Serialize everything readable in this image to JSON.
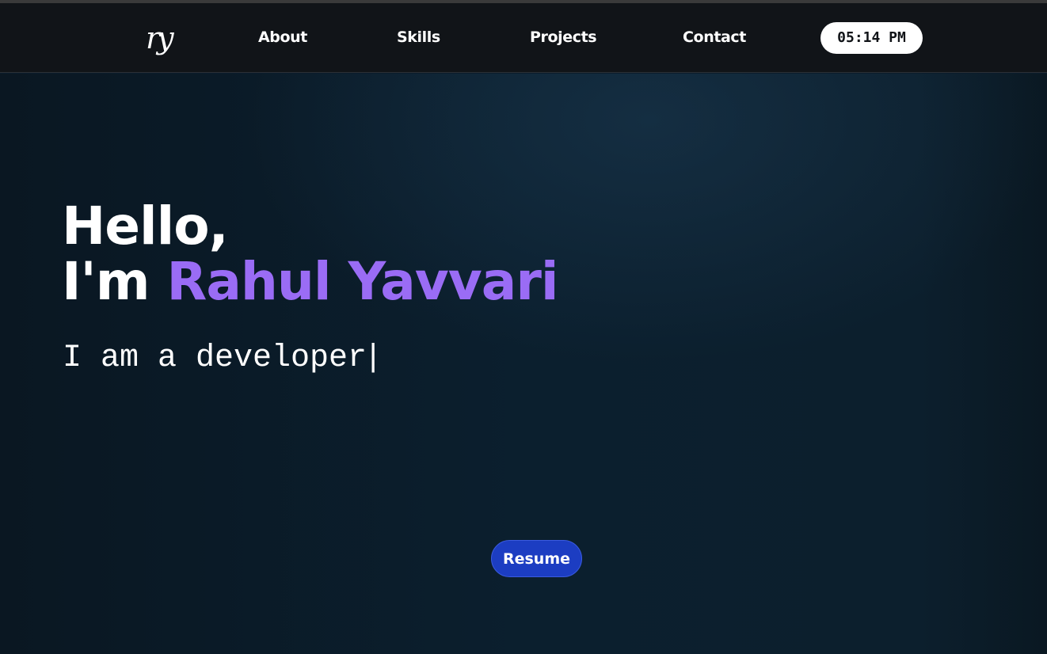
{
  "nav": {
    "logo_text": "ry",
    "links": [
      {
        "label": "About"
      },
      {
        "label": "Skills"
      },
      {
        "label": "Projects"
      },
      {
        "label": "Contact"
      }
    ],
    "clock": "05:14 PM"
  },
  "hero": {
    "greeting_line1": "Hello,",
    "greeting_prefix": "I'm",
    "name": "Rahul Yavvari",
    "typed_text": "I am a developer",
    "cursor": "|",
    "resume_label": "Resume"
  },
  "colors": {
    "nav_background": "#111418",
    "hero_background": "#0b1c2b",
    "name_accent": "#9a6cf5",
    "resume_button": "#1c3dc2",
    "clock_background": "#ffffff"
  }
}
